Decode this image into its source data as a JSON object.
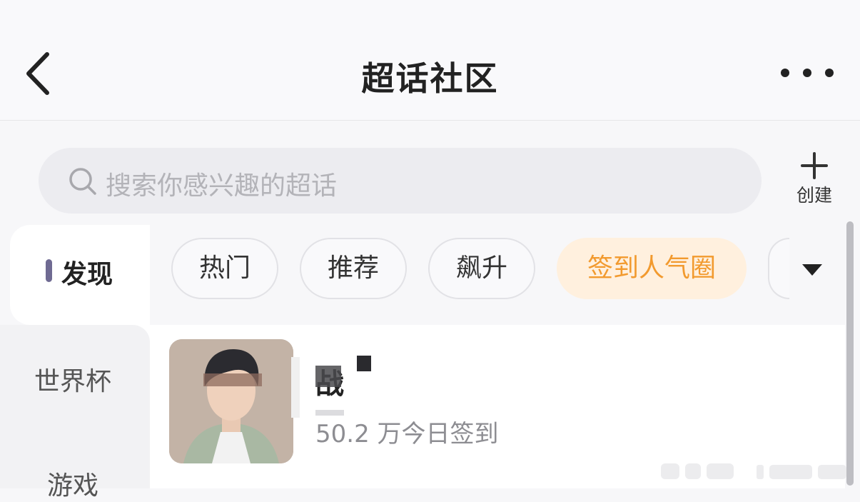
{
  "header": {
    "title": "超话社区",
    "icons": {
      "back": "chevron-left-icon",
      "more": "more-horizontal-icon"
    }
  },
  "search": {
    "placeholder": "搜索你感兴趣的超话",
    "icon": "search-icon"
  },
  "create": {
    "label": "创建",
    "icon": "plus-icon"
  },
  "discover": {
    "label": "发现"
  },
  "chips": [
    {
      "label": "热门",
      "active": false
    },
    {
      "label": "推荐",
      "active": false
    },
    {
      "label": "飙升",
      "active": false
    },
    {
      "label": "签到人气圈",
      "active": true
    }
  ],
  "sidebar": {
    "items": [
      {
        "label": "世界杯"
      },
      {
        "label": "游戏"
      }
    ]
  },
  "topic": {
    "name": "战",
    "stats": "50.2 万今日签到"
  },
  "colors": {
    "accent": "#f29a2e",
    "accent_bg": "#fff0de",
    "indicator": "#6f6a92"
  }
}
